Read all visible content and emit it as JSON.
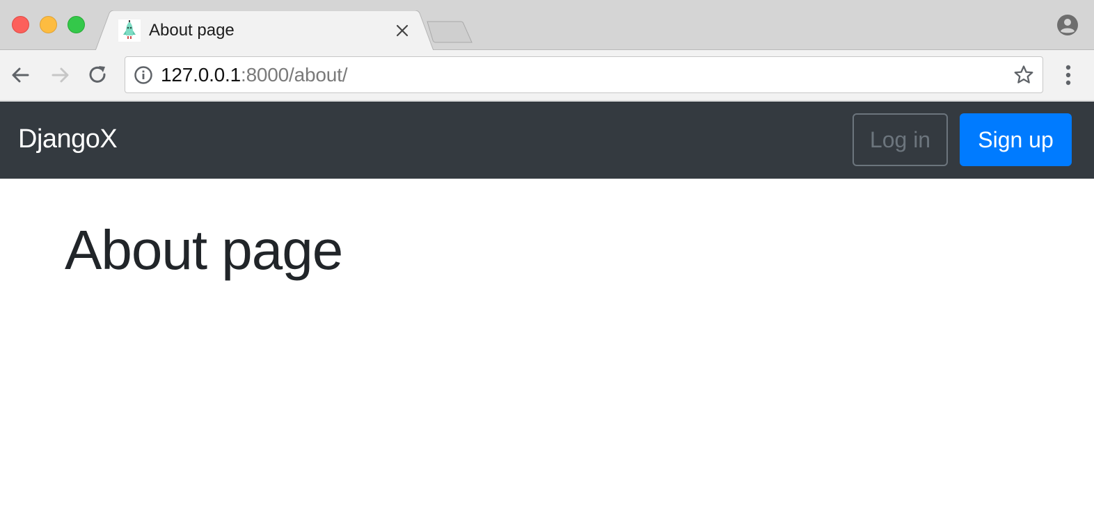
{
  "browser": {
    "tab": {
      "title": "About page",
      "favicon": "rocket-favicon-icon",
      "close_icon": "close-icon"
    },
    "new_tab_icon": "new-tab-icon",
    "profile_icon": "profile-icon",
    "toolbar": {
      "back_icon": "back-arrow-icon",
      "forward_icon": "forward-arrow-icon",
      "reload_icon": "reload-icon",
      "url_host": "127.0.0.1",
      "url_rest": ":8000/about/",
      "info_icon": "info-icon",
      "bookmark_icon": "star-icon",
      "menu_icon": "more-vert-icon"
    }
  },
  "navbar": {
    "brand": "DjangoX",
    "login_label": "Log in",
    "signup_label": "Sign up"
  },
  "main": {
    "heading": "About page"
  },
  "colors": {
    "navbar_bg": "#343a40",
    "primary": "#007bff",
    "secondary": "#6c757d",
    "heading_text": "#212529"
  }
}
